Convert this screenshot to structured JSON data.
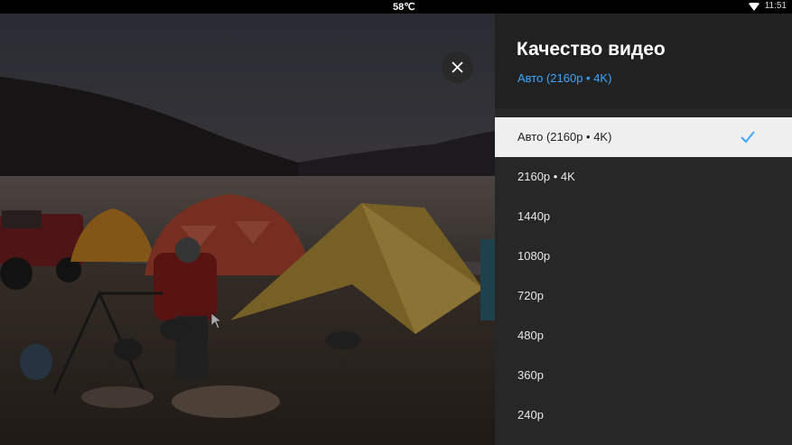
{
  "status_bar": {
    "temperature": "58℃",
    "time": "11:51"
  },
  "icons": {
    "close": "close-icon",
    "check": "check-icon",
    "wifi": "wifi-icon",
    "cursor": "mouse-cursor-icon"
  },
  "colors": {
    "accent": "#3ea6ff",
    "panel_bg": "#272727",
    "selected_bg": "#efefef"
  },
  "panel": {
    "title": "Качество видео",
    "current": "Авто (2160p • 4K)",
    "options": [
      {
        "label": "Авто (2160p • 4K)",
        "selected": true
      },
      {
        "label": "2160p • 4K",
        "selected": false
      },
      {
        "label": "1440p",
        "selected": false
      },
      {
        "label": "1080p",
        "selected": false
      },
      {
        "label": "720p",
        "selected": false
      },
      {
        "label": "480p",
        "selected": false
      },
      {
        "label": "360p",
        "selected": false
      },
      {
        "label": "240p",
        "selected": false
      }
    ]
  }
}
